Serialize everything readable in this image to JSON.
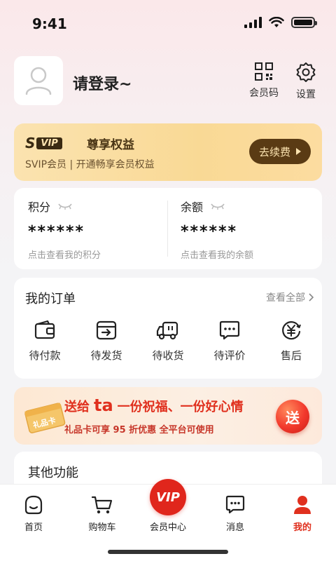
{
  "status_bar": {
    "time": "9:41"
  },
  "header": {
    "login_text": "请登录~",
    "member_code_label": "会员码",
    "settings_label": "设置"
  },
  "svip": {
    "badge_s": "S",
    "badge_vip": "VIP",
    "title": "尊享权益",
    "subtitle": "SVIP会员 | 开通畅享会员权益",
    "renew_label": "去续费"
  },
  "balance": {
    "points": {
      "title": "积分",
      "value": "******",
      "hint": "点击查看我的积分"
    },
    "balance": {
      "title": "余额",
      "value": "******",
      "hint": "点击查看我的余额"
    }
  },
  "orders": {
    "title": "我的订单",
    "view_all": "查看全部",
    "items": [
      {
        "label": "待付款",
        "icon": "wallet-icon"
      },
      {
        "label": "待发货",
        "icon": "box-arrow-icon"
      },
      {
        "label": "待收货",
        "icon": "truck-icon"
      },
      {
        "label": "待评价",
        "icon": "comment-icon"
      },
      {
        "label": "售后",
        "icon": "yen-refund-icon"
      }
    ]
  },
  "gift": {
    "card_label": "礼品卡",
    "main_prefix": "送给",
    "main_ta": "ta",
    "main_suffix": "一份祝福、一份好心情",
    "sub": "礼品卡可享 95 折优惠  全平台可使用",
    "button": "送"
  },
  "other": {
    "title": "其他功能"
  },
  "tabbar": {
    "home": "首页",
    "cart": "购物车",
    "member_badge": "VIP",
    "member": "会员中心",
    "messages": "消息",
    "mine": "我的"
  },
  "colors": {
    "accent": "#e0301e",
    "gold": "#fbe3b0",
    "brown": "#5a3b14"
  }
}
